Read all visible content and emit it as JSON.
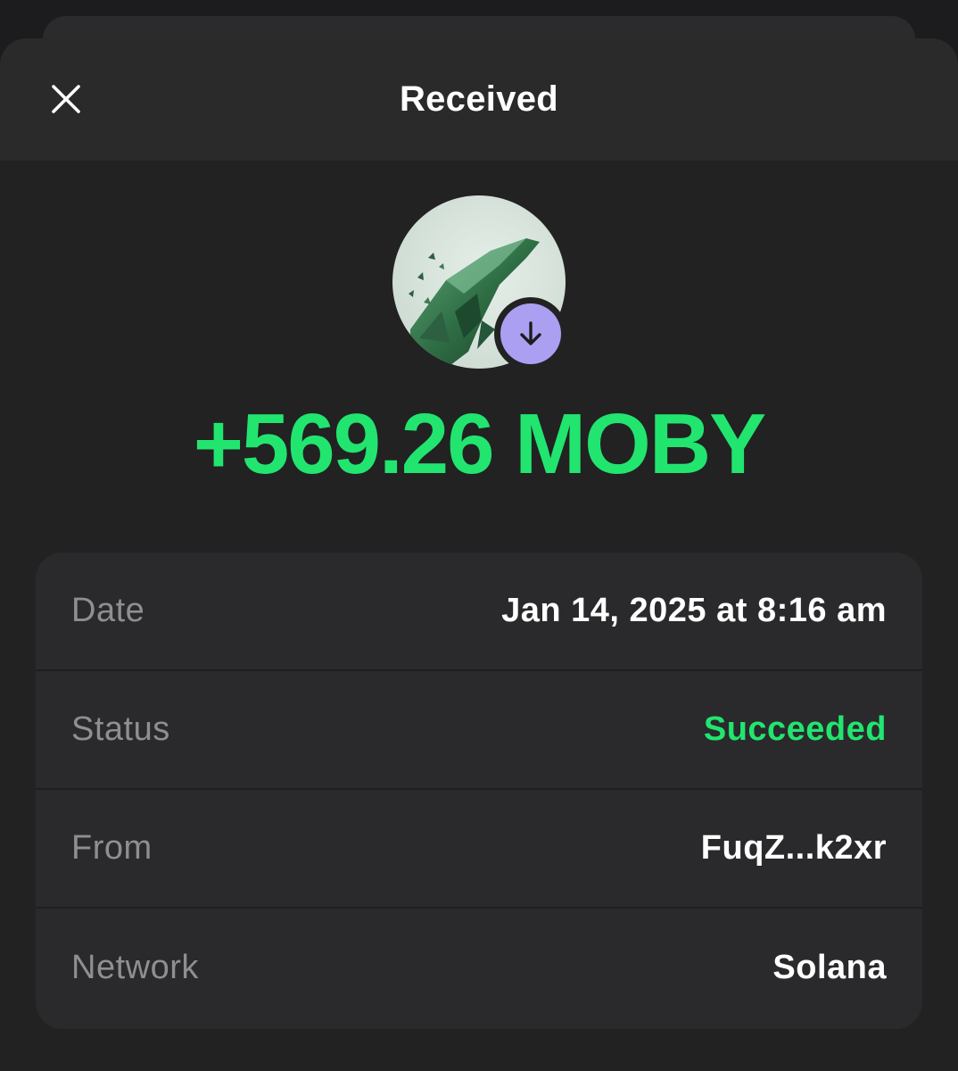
{
  "header": {
    "title": "Received",
    "close_icon": "close-icon"
  },
  "token": {
    "avatar_icon": "moby-whale-token-icon",
    "badge_icon": "arrow-down-icon",
    "badge_color": "#ab9ff2",
    "amount": "+569.26 MOBY",
    "amount_color": "#21e56f"
  },
  "details": {
    "rows": [
      {
        "label": "Date",
        "value": "Jan 14, 2025 at 8:16 am"
      },
      {
        "label": "Status",
        "value": "Succeeded",
        "value_color": "#21e56f"
      },
      {
        "label": "From",
        "value": "FuqZ...k2xr"
      },
      {
        "label": "Network",
        "value": "Solana"
      }
    ]
  }
}
